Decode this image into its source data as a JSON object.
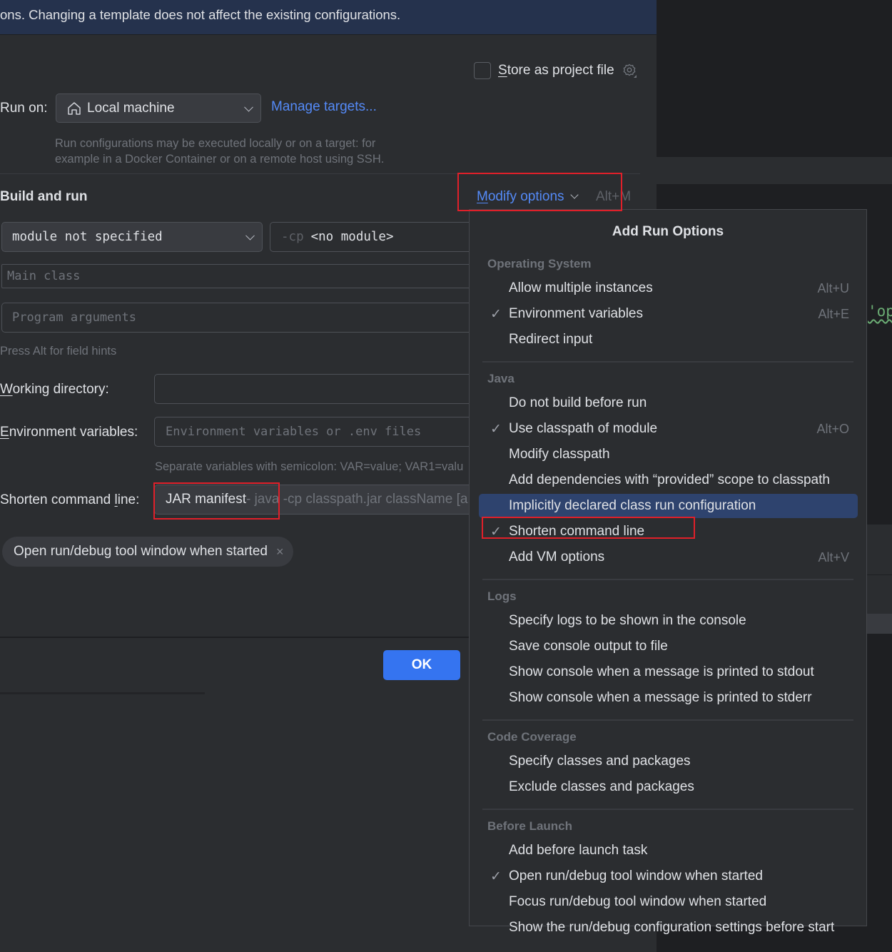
{
  "banner": {
    "text": "ons. Changing a template does not affect the existing configurations."
  },
  "store_project_file": {
    "label_first": "S",
    "label_rest": "tore as project file",
    "checked": false
  },
  "run_on": {
    "label": "Run on:",
    "value": "Local machine",
    "manage_link": "Manage targets...",
    "hint_line1": "Run configurations may be executed locally or on a target: for",
    "hint_line2": "example in a Docker Container or on a remote host using SSH."
  },
  "build_and_run": {
    "title": "Build and run",
    "modify_first": "M",
    "modify_rest": "odify options",
    "modify_shortcut": "Alt+M",
    "module_value": "module not specified",
    "cp_prefix": "-cp",
    "cp_value": "<no module>",
    "main_class_placeholder": "Main class",
    "program_args_placeholder": "Program arguments",
    "field_hint": "Press Alt for field hints"
  },
  "working_directory": {
    "label_first": "W",
    "label_rest": "orking directory:",
    "value": ""
  },
  "environment_variables": {
    "label_first": "E",
    "label_rest": "nvironment variables:",
    "placeholder": "Environment variables or .env files",
    "hint": "Separate variables with semicolon: VAR=value; VAR1=valu"
  },
  "shorten_command_line": {
    "label_pre": "Shorten command ",
    "label_u": "l",
    "label_post": "ine:",
    "value": "JAR manifest",
    "value_desc": " - java -cp classpath.jar className [a"
  },
  "chip": {
    "label": "Open run/debug tool window when started",
    "close": "×"
  },
  "footer": {
    "ok_label": "OK"
  },
  "editor": {
    "code_fragment": "'op"
  },
  "popup": {
    "title": "Add Run Options",
    "check_glyph": "✓",
    "groups": [
      {
        "title": "Operating System",
        "items": [
          {
            "label": "Allow multiple instances",
            "checked": false,
            "shortcut": "Alt+U"
          },
          {
            "label": "Environment variables",
            "checked": true,
            "shortcut": "Alt+E"
          },
          {
            "label": "Redirect input",
            "checked": false,
            "shortcut": ""
          }
        ]
      },
      {
        "title": "Java",
        "items": [
          {
            "label": "Do not build before run",
            "checked": false,
            "shortcut": ""
          },
          {
            "label": "Use classpath of module",
            "checked": true,
            "shortcut": "Alt+O"
          },
          {
            "label": "Modify classpath",
            "checked": false,
            "shortcut": ""
          },
          {
            "label": "Add dependencies with “provided” scope to classpath",
            "checked": false,
            "shortcut": ""
          },
          {
            "label": "Implicitly declared class run configuration",
            "checked": false,
            "shortcut": "",
            "selected": true
          },
          {
            "label": "Shorten command line",
            "checked": true,
            "shortcut": ""
          },
          {
            "label": "Add VM options",
            "checked": false,
            "shortcut": "Alt+V"
          }
        ]
      },
      {
        "title": "Logs",
        "items": [
          {
            "label": "Specify logs to be shown in the console",
            "checked": false,
            "shortcut": ""
          },
          {
            "label": "Save console output to file",
            "checked": false,
            "shortcut": ""
          },
          {
            "label": "Show console when a message is printed to stdout",
            "checked": false,
            "shortcut": ""
          },
          {
            "label": "Show console when a message is printed to stderr",
            "checked": false,
            "shortcut": ""
          }
        ]
      },
      {
        "title": "Code Coverage",
        "items": [
          {
            "label": "Specify classes and packages",
            "checked": false,
            "shortcut": ""
          },
          {
            "label": "Exclude classes and packages",
            "checked": false,
            "shortcut": ""
          }
        ]
      },
      {
        "title": "Before Launch",
        "items": [
          {
            "label": "Add before launch task",
            "checked": false,
            "shortcut": ""
          },
          {
            "label": "Open run/debug tool window when started",
            "checked": true,
            "shortcut": ""
          },
          {
            "label": "Focus run/debug tool window when started",
            "checked": false,
            "shortcut": ""
          },
          {
            "label": "Show the run/debug configuration settings before start",
            "checked": false,
            "shortcut": ""
          }
        ]
      }
    ]
  }
}
